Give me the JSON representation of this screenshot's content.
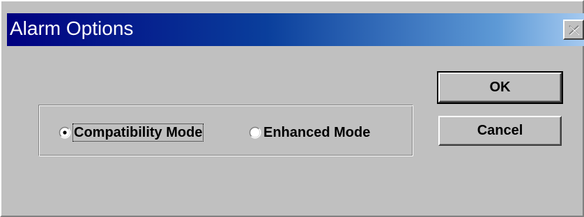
{
  "window": {
    "title": "Alarm Options",
    "close_icon": "close-icon"
  },
  "mode_group": {
    "options": [
      {
        "label": "Compatibility Mode",
        "selected": true,
        "focused": true
      },
      {
        "label": "Enhanced Mode",
        "selected": false,
        "focused": false
      }
    ]
  },
  "buttons": {
    "ok_label": "OK",
    "cancel_label": "Cancel"
  },
  "colors": {
    "face": "#c0c0c0",
    "title_start": "#000080",
    "title_end": "#a6caf0"
  }
}
